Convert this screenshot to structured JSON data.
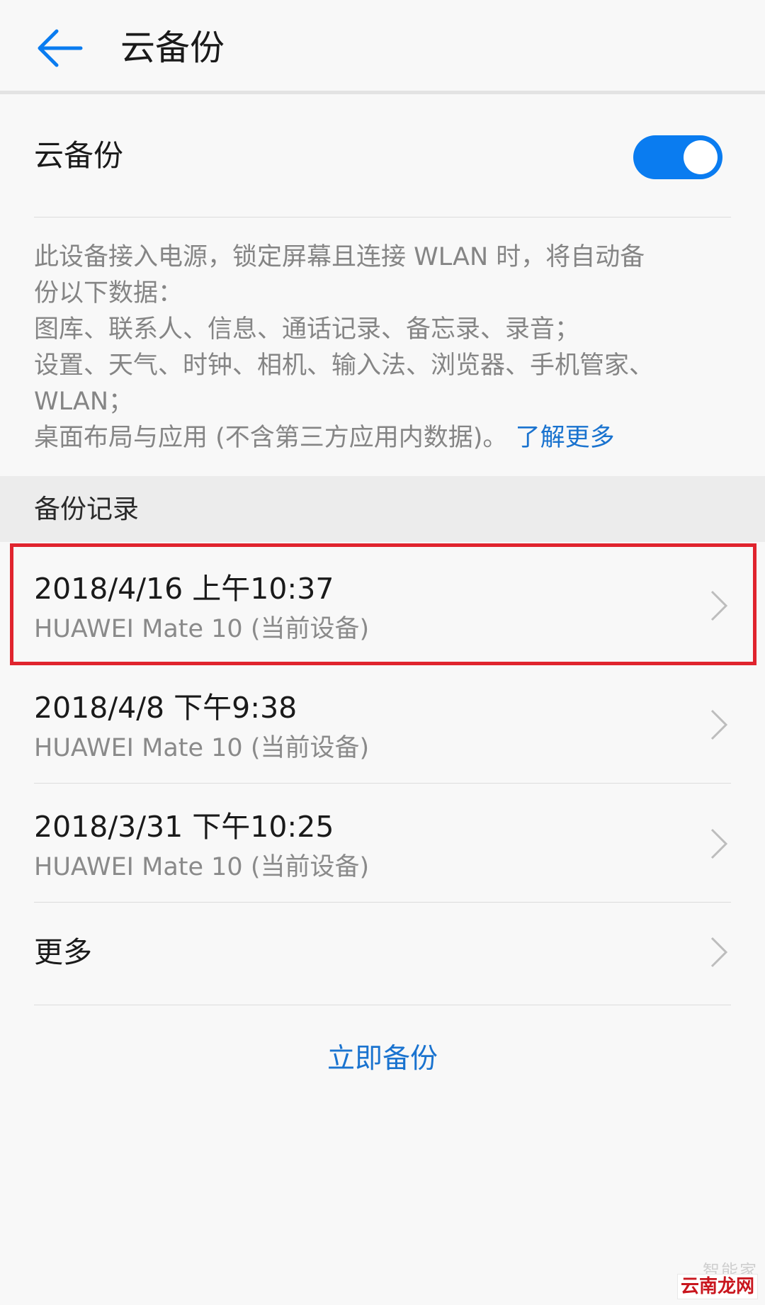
{
  "header": {
    "back_icon": "arrow-left-icon",
    "title": "云备份"
  },
  "colors": {
    "accent": "#0a7cf0",
    "link": "#1a73cf",
    "highlight": "#e0242e"
  },
  "toggle": {
    "label": "云备份",
    "enabled": true
  },
  "description": {
    "line1": "此设备接入电源，锁定屏幕且连接 WLAN 时，将自动备",
    "line2": "份以下数据：",
    "line3": "图库、联系人、信息、通话记录、备忘录、录音；",
    "line4": "设置、天气、时钟、相机、输入法、浏览器、手机管家、",
    "line5": "WLAN；",
    "line6": "桌面布局与应用 (不含第三方应用内数据)。",
    "learn_more": "了解更多"
  },
  "records": {
    "section_title": "备份记录",
    "items": [
      {
        "date": "2018/4/16 上午10:37",
        "device": "HUAWEI Mate 10 (当前设备)",
        "highlighted": true
      },
      {
        "date": "2018/4/8 下午9:38",
        "device": "HUAWEI Mate 10 (当前设备)",
        "highlighted": false
      },
      {
        "date": "2018/3/31 下午10:25",
        "device": "HUAWEI Mate 10 (当前设备)",
        "highlighted": false
      }
    ],
    "chevron_icon": "chevron-right-icon"
  },
  "more": {
    "label": "更多"
  },
  "actions": {
    "backup_now": "立即备份"
  },
  "watermark": {
    "top_text": "智能家",
    "main_text": "云南龙网"
  }
}
